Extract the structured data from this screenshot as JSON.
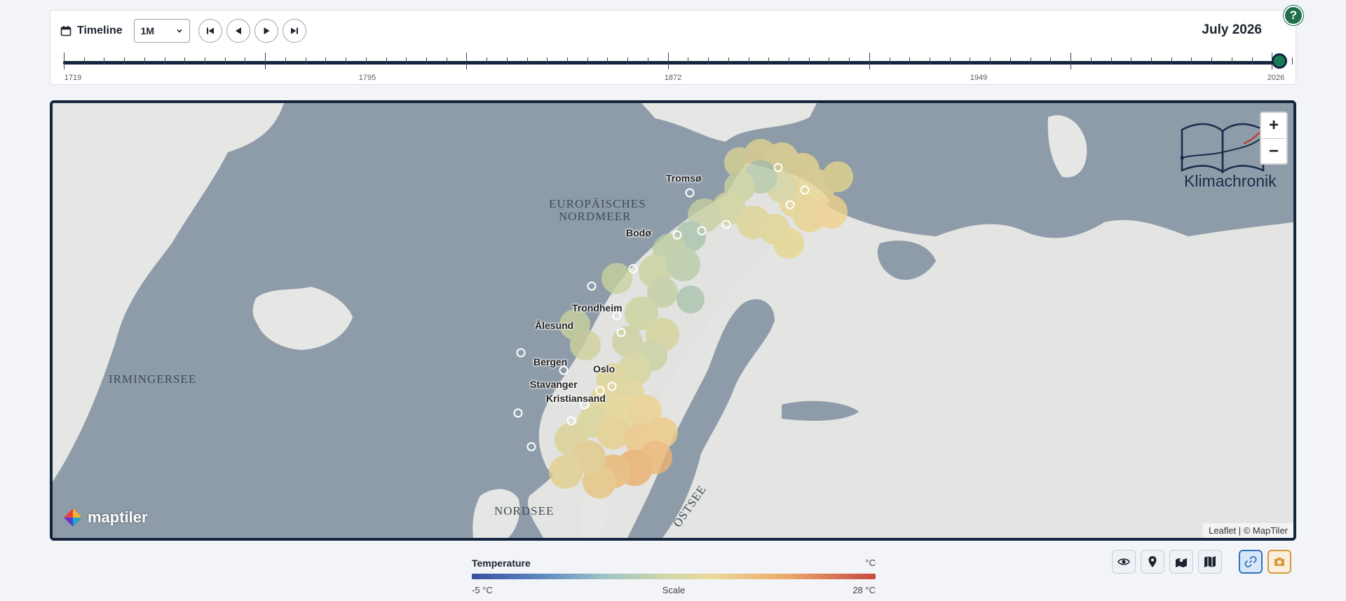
{
  "timeline": {
    "title": "Timeline",
    "resolution": "1M",
    "current_date": "July 2026",
    "labels": [
      "1719",
      "1795",
      "1872",
      "1949",
      "2026"
    ],
    "position_fraction": 1.0
  },
  "help": {
    "label": "?"
  },
  "map": {
    "sea_labels": {
      "nordmeer_1": "Europäisches",
      "nordmeer_2": "Nordmeer",
      "irmingersee": "Irmingersee",
      "nordsee": "Nordsee",
      "ostsee": "Ostsee"
    },
    "cities": {
      "tromso": "Tromsø",
      "bodo": "Bodø",
      "trondheim": "Trondheim",
      "alesund": "Ålesund",
      "bergen": "Bergen",
      "oslo": "Oslo",
      "stavanger": "Stavanger",
      "kristiansand": "Kristiansand"
    },
    "zoom_in": "+",
    "zoom_out": "−",
    "logo_text": "Klimachronik",
    "maptiler": "maptiler",
    "attribution": "Leaflet | © MapTiler"
  },
  "legend": {
    "title": "Temperature",
    "unit": "°C",
    "min": "-5 °C",
    "mid": "Scale",
    "max": "28 °C"
  },
  "tools": [
    "eye-icon",
    "map-pin-icon",
    "map-layers-icon",
    "map-icon",
    "link-icon",
    "camera-icon"
  ],
  "colors": {
    "navy": "#14243d",
    "accent_green": "#1a7b57",
    "link_blue": "#2f74c0",
    "camera_orange": "#d59a3a"
  }
}
